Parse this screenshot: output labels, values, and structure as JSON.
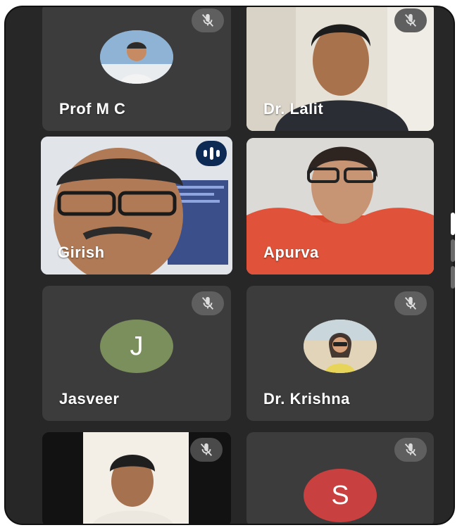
{
  "participants": [
    {
      "name": "Prof M C",
      "muted": true,
      "avatar_type": "photo"
    },
    {
      "name": "Dr. Lalit",
      "muted": true,
      "avatar_type": "video"
    },
    {
      "name": "Girish",
      "muted": false,
      "speaking": true,
      "avatar_type": "video"
    },
    {
      "name": "Apurva",
      "muted": false,
      "avatar_type": "video"
    },
    {
      "name": "Jasveer",
      "muted": true,
      "avatar_type": "initial",
      "initial": "J",
      "avatar_color": "#7b8f5c"
    },
    {
      "name": "Dr. Krishna",
      "muted": true,
      "avatar_type": "photo"
    },
    {
      "name": "",
      "muted": true,
      "avatar_type": "video"
    },
    {
      "name": "",
      "muted": true,
      "avatar_type": "initial",
      "initial": "S",
      "avatar_color": "#c8403f"
    }
  ],
  "icons": {
    "muted": "mic-off-icon",
    "speaking": "audio-level-icon"
  },
  "colors": {
    "background": "#272727",
    "tile": "#3c3c3c",
    "active_outline": "#8fa2d6",
    "speaking_badge": "#0d2a55"
  }
}
